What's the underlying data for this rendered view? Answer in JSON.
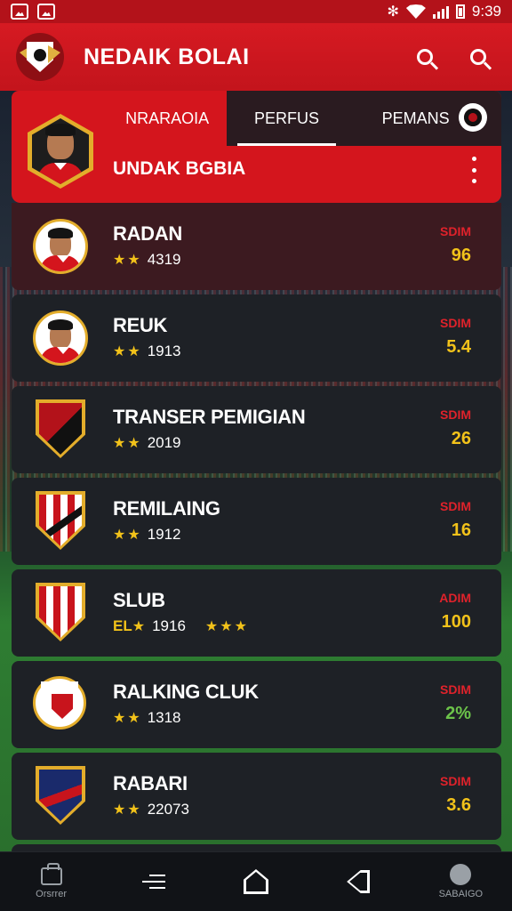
{
  "status_bar": {
    "time": "9:39"
  },
  "app": {
    "title": "NEDAIK BOLAI"
  },
  "tabs": [
    {
      "label": "NRARAOIA"
    },
    {
      "label": "PERFUS"
    },
    {
      "label": "PEMANS"
    }
  ],
  "header_card": {
    "name": "UNDAK BGBIA"
  },
  "rows": [
    {
      "name": "RADAN",
      "prefix": "",
      "stars": "★★",
      "sub": "4319",
      "extra_stars": "",
      "stat_label": "SDIM",
      "stat_value": "96",
      "value_color": "#f2c21a",
      "avatar": "player"
    },
    {
      "name": "REUK",
      "prefix": "",
      "stars": "★★",
      "sub": "1913",
      "extra_stars": "",
      "stat_label": "SDIM",
      "stat_value": "5.4",
      "value_color": "#f2c21a",
      "avatar": "player"
    },
    {
      "name": "TRANSER PEMIGIAN",
      "prefix": "",
      "stars": "★★",
      "sub": "2019",
      "extra_stars": "",
      "stat_label": "SDIM",
      "stat_value": "26",
      "value_color": "#f2c21a",
      "avatar": "club-shield"
    },
    {
      "name": "REMILAING",
      "prefix": "",
      "stars": "★★",
      "sub": "1912",
      "extra_stars": "",
      "stat_label": "SDIM",
      "stat_value": "16",
      "value_color": "#f2c21a",
      "avatar": "club-stripes"
    },
    {
      "name": "SLUB",
      "prefix": "EL",
      "stars": "★",
      "sub": "1916",
      "extra_stars": "★★★",
      "stat_label": "ADIM",
      "stat_value": "100",
      "value_color": "#f2c21a",
      "avatar": "club-stripes"
    },
    {
      "name": "RALKING CLUK",
      "prefix": "",
      "stars": "★★",
      "sub": "1318",
      "extra_stars": "",
      "stat_label": "SDIM",
      "stat_value": "2%",
      "value_color": "#6cc34a",
      "avatar": "club-round"
    },
    {
      "name": "RABARI",
      "prefix": "",
      "stars": "★★",
      "sub": "22073",
      "extra_stars": "",
      "stat_label": "SDIM",
      "stat_value": "3.6",
      "value_color": "#f2c21a",
      "avatar": "club-navy"
    }
  ],
  "bottom_nav": [
    {
      "label": "Orsrrer",
      "icon": "bag-icon"
    },
    {
      "label": "",
      "icon": "menu-icon"
    },
    {
      "label": "",
      "icon": "home-icon"
    },
    {
      "label": "",
      "icon": "tag-icon"
    },
    {
      "label": "SABAIGO",
      "icon": "user-icon"
    }
  ],
  "colors": {
    "brand_red": "#d4151d",
    "gold": "#f2c21a",
    "card_dark": "#1e2126"
  }
}
